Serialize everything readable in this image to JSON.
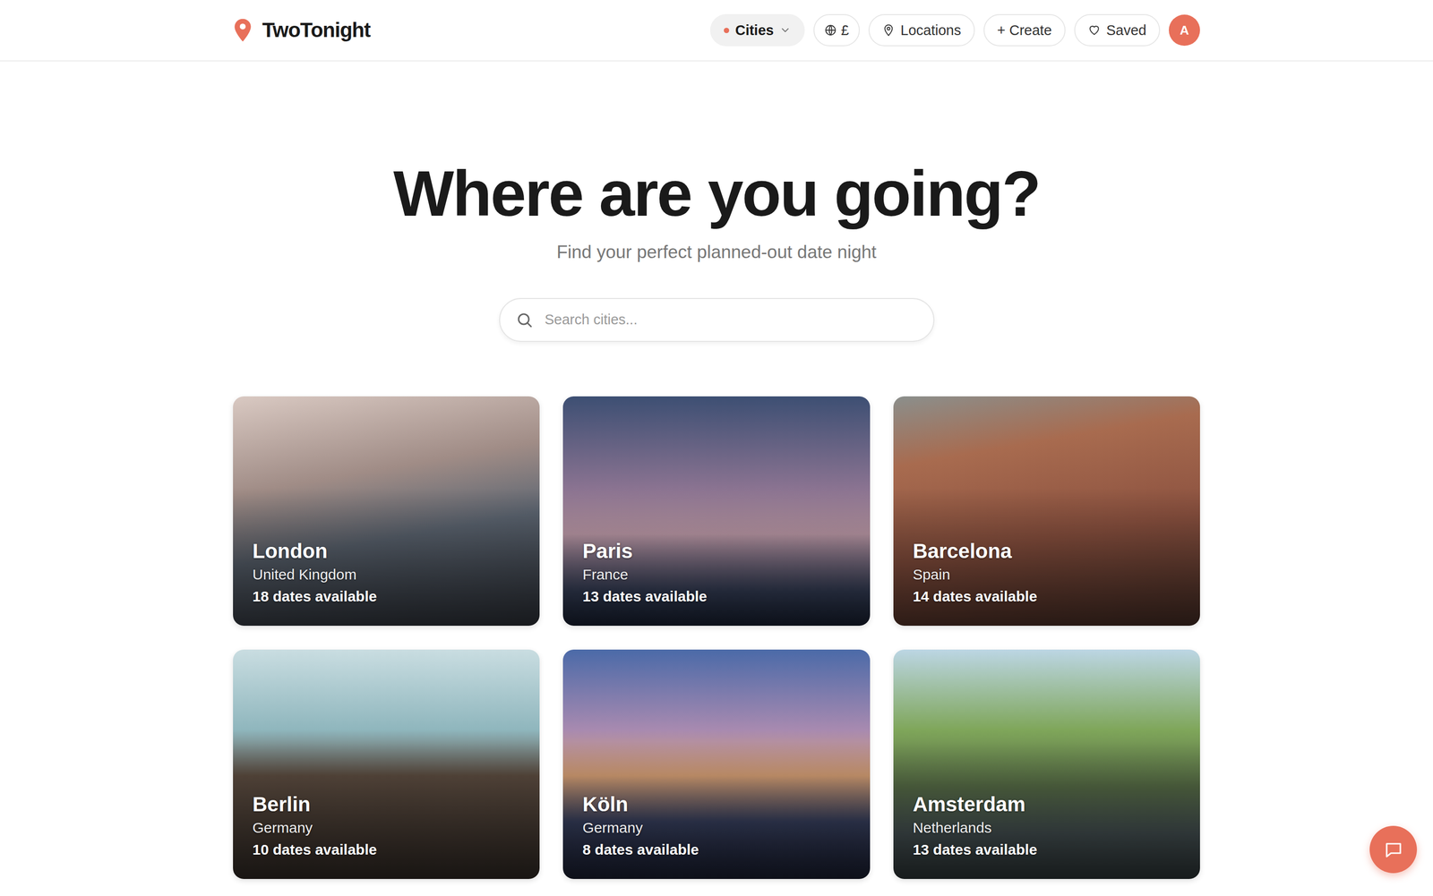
{
  "brand": {
    "name": "TwoTonight"
  },
  "nav": {
    "cities": "Cities",
    "currency": "£",
    "locations": "Locations",
    "create": "+ Create",
    "saved": "Saved",
    "avatar": "A"
  },
  "hero": {
    "title": "Where are you going?",
    "subtitle": "Find your perfect planned-out date night"
  },
  "search": {
    "placeholder": "Search cities..."
  },
  "cities": [
    {
      "name": "London",
      "country": "United Kingdom",
      "dates": "18 dates available"
    },
    {
      "name": "Paris",
      "country": "France",
      "dates": "13 dates available"
    },
    {
      "name": "Barcelona",
      "country": "Spain",
      "dates": "14 dates available"
    },
    {
      "name": "Berlin",
      "country": "Germany",
      "dates": "10 dates available"
    },
    {
      "name": "Köln",
      "country": "Germany",
      "dates": "8 dates available"
    },
    {
      "name": "Amsterdam",
      "country": "Netherlands",
      "dates": "13 dates available"
    }
  ]
}
